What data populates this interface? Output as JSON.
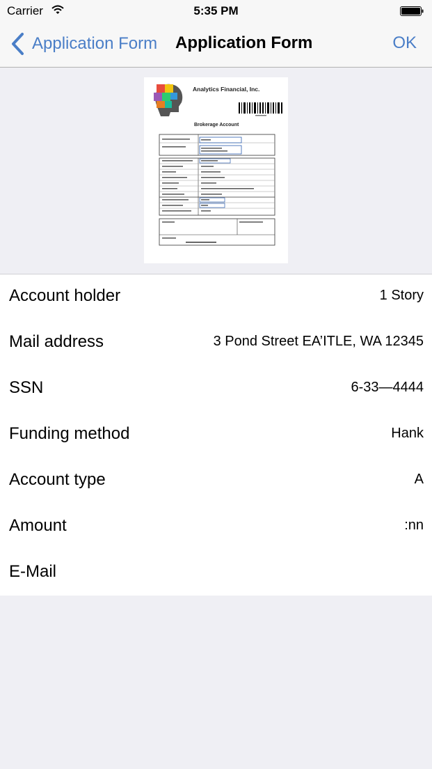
{
  "status_bar": {
    "carrier": "Carrier",
    "time": "5:35 PM"
  },
  "navbar": {
    "back_label": "Application Form",
    "title": "Application Form",
    "ok_label": "OK"
  },
  "accent_color": "#4a7ec7",
  "document_preview": {
    "company": "Analytics Financial, Inc.",
    "form_title": "Brokerage Account"
  },
  "fields": [
    {
      "label": "Account holder",
      "value": "1 Story"
    },
    {
      "label": "Mail address",
      "value": "3 Pond Street EA’ITLE, WA 12345"
    },
    {
      "label": "SSN",
      "value": "6-33—4444"
    },
    {
      "label": "Funding method",
      "value": "Hank"
    },
    {
      "label": "Account type",
      "value": "A"
    },
    {
      "label": "Amount",
      "value": ":nn"
    },
    {
      "label": "E-Mail",
      "value": ""
    }
  ]
}
